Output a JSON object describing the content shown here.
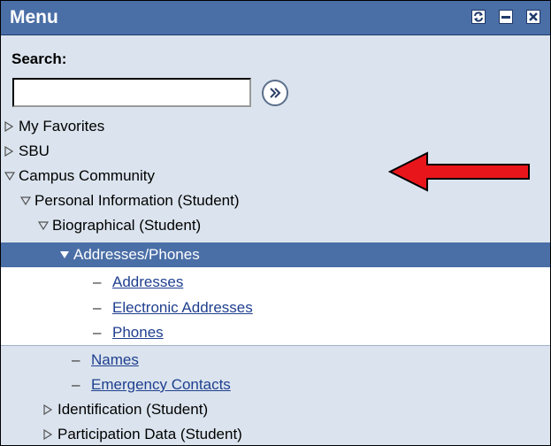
{
  "menu": {
    "title": "Menu",
    "search_label": "Search:",
    "search_value": "",
    "title_buttons": [
      "refresh-icon",
      "minimize-icon",
      "close-icon"
    ]
  },
  "tree": [
    {
      "label": "My Favorites",
      "kind": "collapsed",
      "level": 0
    },
    {
      "label": "SBU",
      "kind": "collapsed",
      "level": 0
    },
    {
      "label": "Campus Community",
      "kind": "expanded",
      "level": 0
    },
    {
      "label": "Personal Information (Student)",
      "kind": "expanded",
      "level": 1
    },
    {
      "label": "Biographical (Student)",
      "kind": "expanded",
      "level": 2
    },
    {
      "label": "Addresses/Phones",
      "kind": "expanded-selected",
      "level": 3
    },
    {
      "label": "Addresses",
      "kind": "link",
      "level": 4
    },
    {
      "label": "Electronic Addresses",
      "kind": "link",
      "level": 4
    },
    {
      "label": "Phones",
      "kind": "link",
      "level": 4
    },
    {
      "label": "Names",
      "kind": "link",
      "level": 3
    },
    {
      "label": "Emergency Contacts",
      "kind": "link",
      "level": 3
    },
    {
      "label": "Identification (Student)",
      "kind": "collapsed",
      "level": 2
    },
    {
      "label": "Participation Data (Student)",
      "kind": "collapsed",
      "level": 2
    }
  ],
  "colors": {
    "titlebar": "#4a6ea6",
    "panel_bg": "#dbe4ee",
    "selected_bg": "#4a6ea6",
    "link": "#1f3f8f",
    "annotation_arrow": "#e8161b"
  }
}
